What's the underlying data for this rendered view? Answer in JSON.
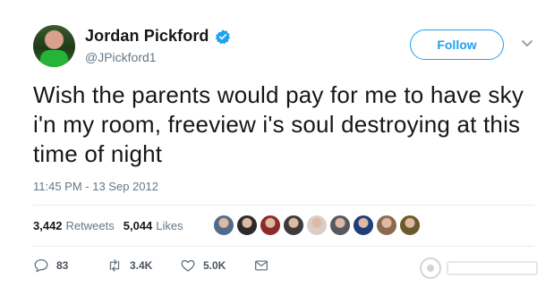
{
  "user": {
    "display_name": "Jordan Pickford",
    "handle": "@JPickford1"
  },
  "follow_label": "Follow",
  "tweet_text": "Wish the parents would pay for me to have sky i'n my room, freeview i's soul destroying at this time of night",
  "timestamp": "11:45 PM - 13 Sep 2012",
  "stats": {
    "retweets_count": "3,442",
    "retweets_label": "Retweets",
    "likes_count": "5,044",
    "likes_label": "Likes"
  },
  "likers": [
    {
      "icon": "liker-avatar",
      "color": "#4f6d8a"
    },
    {
      "icon": "liker-avatar",
      "color": "#2b2b2b"
    },
    {
      "icon": "liker-avatar",
      "color": "#8b2b2b"
    },
    {
      "icon": "liker-avatar",
      "color": "#3c3c3c"
    },
    {
      "icon": "liker-avatar",
      "color": "#d9cfc8"
    },
    {
      "icon": "liker-avatar",
      "color": "#555a60"
    },
    {
      "icon": "liker-avatar",
      "color": "#1f3e78"
    },
    {
      "icon": "liker-avatar",
      "color": "#8a6b52"
    },
    {
      "icon": "liker-avatar",
      "color": "#6b5a2a"
    }
  ],
  "actions": {
    "reply_count": "83",
    "retweet_count": "3.4K",
    "like_count": "5.0K"
  },
  "colors": {
    "accent": "#1da1f2",
    "secondary_text": "#657786",
    "text": "#14171a"
  }
}
